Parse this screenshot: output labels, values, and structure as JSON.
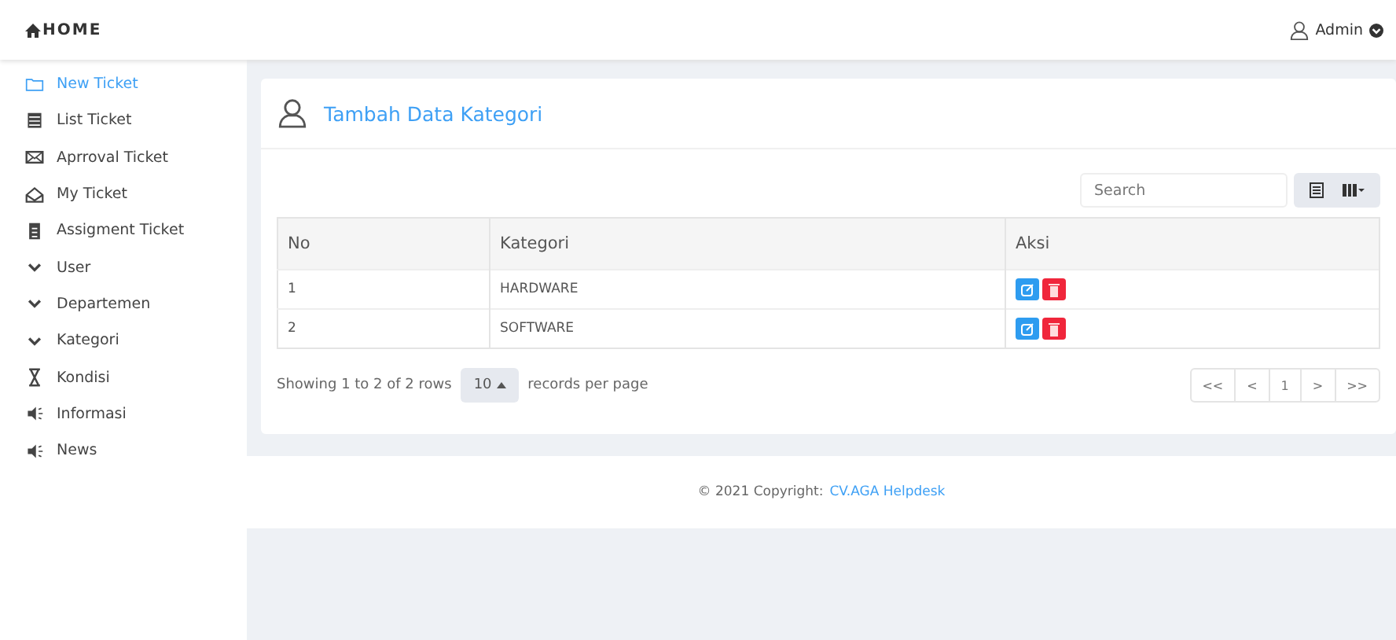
{
  "header": {
    "brand": "HOME",
    "user": "Admin"
  },
  "sidebar": {
    "items": [
      {
        "label": "New Ticket",
        "kind": "link",
        "selected": true
      },
      {
        "label": "List Ticket",
        "kind": "link",
        "selected": false
      },
      {
        "label": "Aprroval Ticket",
        "kind": "link",
        "selected": false
      },
      {
        "label": "My Ticket",
        "kind": "link",
        "selected": false
      },
      {
        "label": "Assigment Ticket",
        "kind": "link",
        "selected": false
      },
      {
        "label": "User",
        "kind": "group",
        "selected": false
      },
      {
        "label": "Departemen",
        "kind": "group",
        "selected": false
      },
      {
        "label": "Kategori",
        "kind": "group",
        "selected": false
      },
      {
        "label": "Kondisi",
        "kind": "link",
        "selected": false
      },
      {
        "label": "Informasi",
        "kind": "link",
        "selected": false
      },
      {
        "label": "News",
        "kind": "link",
        "selected": false
      }
    ]
  },
  "card": {
    "title": "Tambah Data Kategori",
    "search": {
      "placeholder": "Search"
    },
    "table": {
      "columns": [
        "No",
        "Kategori",
        "Aksi"
      ],
      "rows": [
        {
          "no": "1",
          "kategori": "HARDWARE"
        },
        {
          "no": "2",
          "kategori": "SOFTWARE"
        }
      ]
    },
    "pagination_info": {
      "before": "Showing 1 to 2 of 2 rows",
      "page_size": "10",
      "after": "records per page"
    },
    "pages": [
      {
        "label": "<<",
        "selected": false
      },
      {
        "label": "<",
        "selected": false
      },
      {
        "label": "1",
        "selected": false
      },
      {
        "label": ">",
        "selected": false
      },
      {
        "label": ">>",
        "selected": false
      }
    ]
  },
  "footer": {
    "text": "© 2021 Copyright:",
    "link": "CV.AGA Helpdesk"
  }
}
